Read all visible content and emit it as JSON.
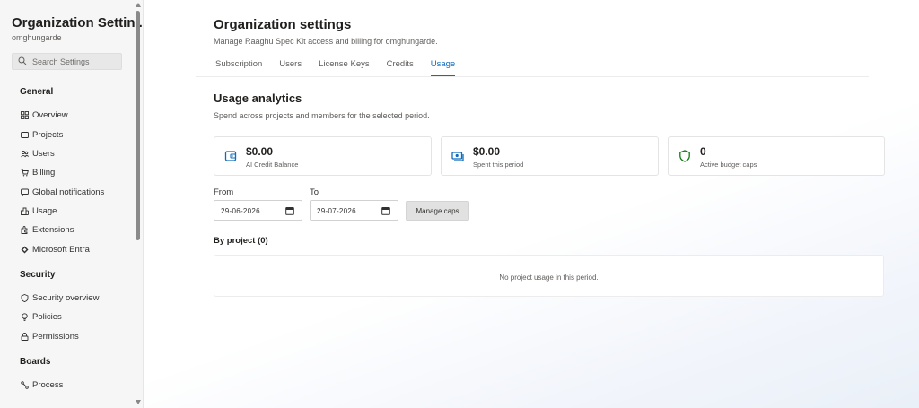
{
  "sidebar": {
    "org_title": "Organization Settin...",
    "org_subtitle": "omghungarde",
    "search_placeholder": "Search Settings",
    "sections": {
      "general": {
        "heading": "General",
        "items": [
          {
            "label": "Overview",
            "icon": "grid-icon"
          },
          {
            "label": "Projects",
            "icon": "projects-icon"
          },
          {
            "label": "Users",
            "icon": "users-icon"
          },
          {
            "label": "Billing",
            "icon": "cart-icon"
          },
          {
            "label": "Global notifications",
            "icon": "notification-icon"
          },
          {
            "label": "Usage",
            "icon": "usage-icon"
          },
          {
            "label": "Extensions",
            "icon": "extensions-icon"
          },
          {
            "label": "Microsoft Entra",
            "icon": "entra-icon"
          }
        ]
      },
      "security": {
        "heading": "Security",
        "items": [
          {
            "label": "Security overview",
            "icon": "shield-icon"
          },
          {
            "label": "Policies",
            "icon": "lightbulb-icon"
          },
          {
            "label": "Permissions",
            "icon": "lock-icon"
          }
        ]
      },
      "boards": {
        "heading": "Boards",
        "items": [
          {
            "label": "Process",
            "icon": "process-icon"
          }
        ]
      }
    }
  },
  "header": {
    "title": "Organization settings",
    "description": "Manage Raaghu Spec Kit access and billing for omghungarde."
  },
  "tabs": [
    {
      "label": "Subscription",
      "active": false
    },
    {
      "label": "Users",
      "active": false
    },
    {
      "label": "License Keys",
      "active": false
    },
    {
      "label": "Credits",
      "active": false
    },
    {
      "label": "Usage",
      "active": true
    }
  ],
  "usage": {
    "title": "Usage analytics",
    "description": "Spend across projects and members for the selected period.",
    "cards": [
      {
        "value": "$0.00",
        "label": "AI Credit Balance",
        "icon": "wallet-icon"
      },
      {
        "value": "$0.00",
        "label": "Spent this period",
        "icon": "money-icon"
      },
      {
        "value": "0",
        "label": "Active budget caps",
        "icon": "shield-icon"
      }
    ],
    "from_label": "From",
    "to_label": "To",
    "from_value": "29-06-2026",
    "to_value": "29-07-2026",
    "manage_caps_label": "Manage caps",
    "by_project_label": "By project (0)",
    "empty_text": "No project usage in this period."
  },
  "colors": {
    "accent": "#0f6cbd",
    "card_icon_blue": "#0f6cbd",
    "card_icon_green": "#107c10"
  }
}
